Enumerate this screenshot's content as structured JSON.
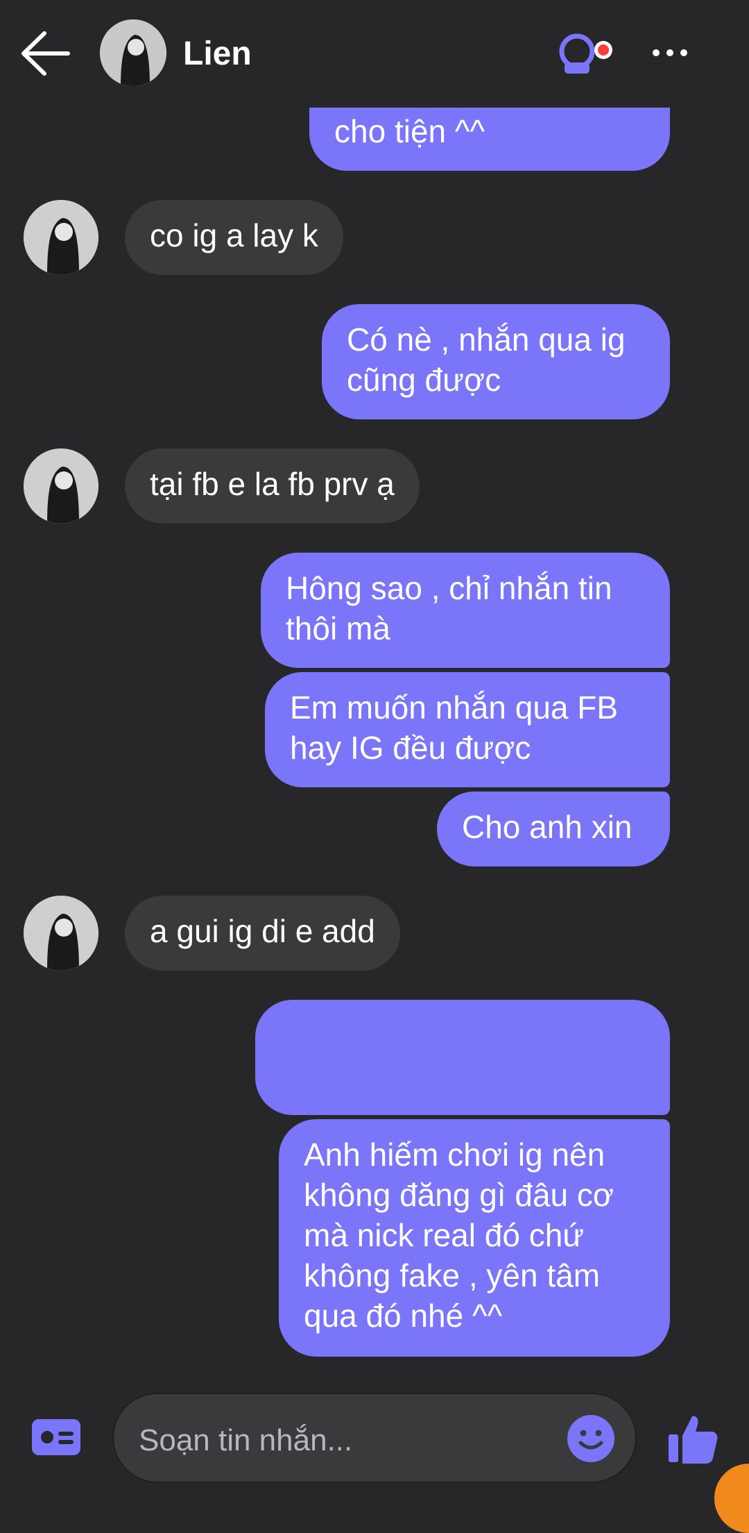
{
  "header": {
    "contact_name": "Lien",
    "back_icon": "arrow-left-icon",
    "call_icon": "video-call-icon",
    "more_icon": "more-dots-icon"
  },
  "colors": {
    "background": "#27272a",
    "outgoing_bubble": "#7b75f9",
    "incoming_bubble": "#3a3a3d",
    "accent": "#7b75f9",
    "notification_dot": "#ff3b3b"
  },
  "messages": [
    {
      "direction": "out",
      "text": "cho tiện ^^"
    },
    {
      "direction": "in",
      "text": "co ig a lay k"
    },
    {
      "direction": "out",
      "text": "Có nè , nhắn qua ig\ncũng được"
    },
    {
      "direction": "in",
      "text": "tại fb e la fb prv ạ"
    },
    {
      "direction": "out",
      "text": "Hông sao , chỉ nhắn tin\nthôi mà"
    },
    {
      "direction": "out",
      "text": "Em muốn nhắn qua FB\nhay IG đều được"
    },
    {
      "direction": "out",
      "text": "Cho anh xin"
    },
    {
      "direction": "in",
      "text": "a gui ig di e add"
    },
    {
      "direction": "out",
      "text": ""
    },
    {
      "direction": "out",
      "text": "Anh hiếm chơi ig nên\nkhông đăng gì đâu cơ\nmà nick real đó chứ\nkhông fake , yên tâm\nqua đó nhé ^^"
    }
  ],
  "composer": {
    "placeholder": "Soạn tin nhắn...",
    "card_icon": "contact-card-icon",
    "emoji_icon": "emoji-icon",
    "like_icon": "thumbs-up-icon"
  }
}
